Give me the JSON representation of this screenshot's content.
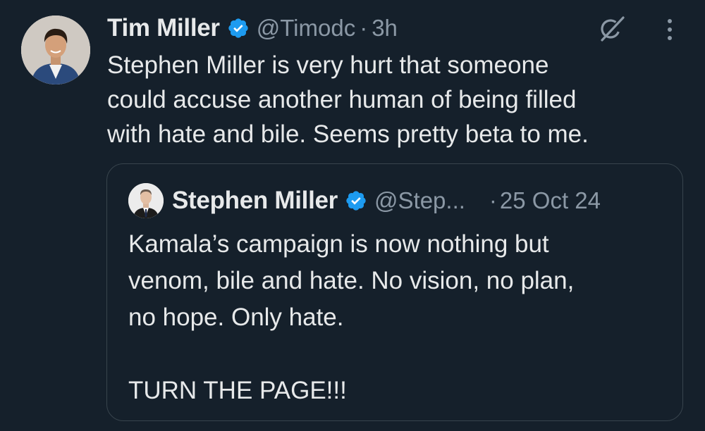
{
  "tweet": {
    "author_name": "Tim Miller",
    "author_handle": "@Timodc",
    "separator": "·",
    "time": "3h",
    "text": "Stephen Miller is very hurt that someone\ncould accuse another human of being filled\nwith hate and bile. Seems pretty beta to me.",
    "verified_badge_icon": "verified-badge-icon",
    "grok_icon": "grok-icon",
    "more_icon": "more-options-icon"
  },
  "quoted_tweet": {
    "author_name": "Stephen Miller",
    "author_handle": "@Step...",
    "separator": "·",
    "time": "25 Oct 24",
    "text": "Kamala’s campaign is now nothing but\nvenom, bile and hate. No vision, no plan,\nno hope. Only hate.\n\nTURN THE PAGE!!!"
  },
  "colors": {
    "background": "#15202b",
    "text_primary": "#e7e9ea",
    "text_secondary": "#8b98a5",
    "verified_blue": "#1d9bf0",
    "border": "#38444d"
  }
}
